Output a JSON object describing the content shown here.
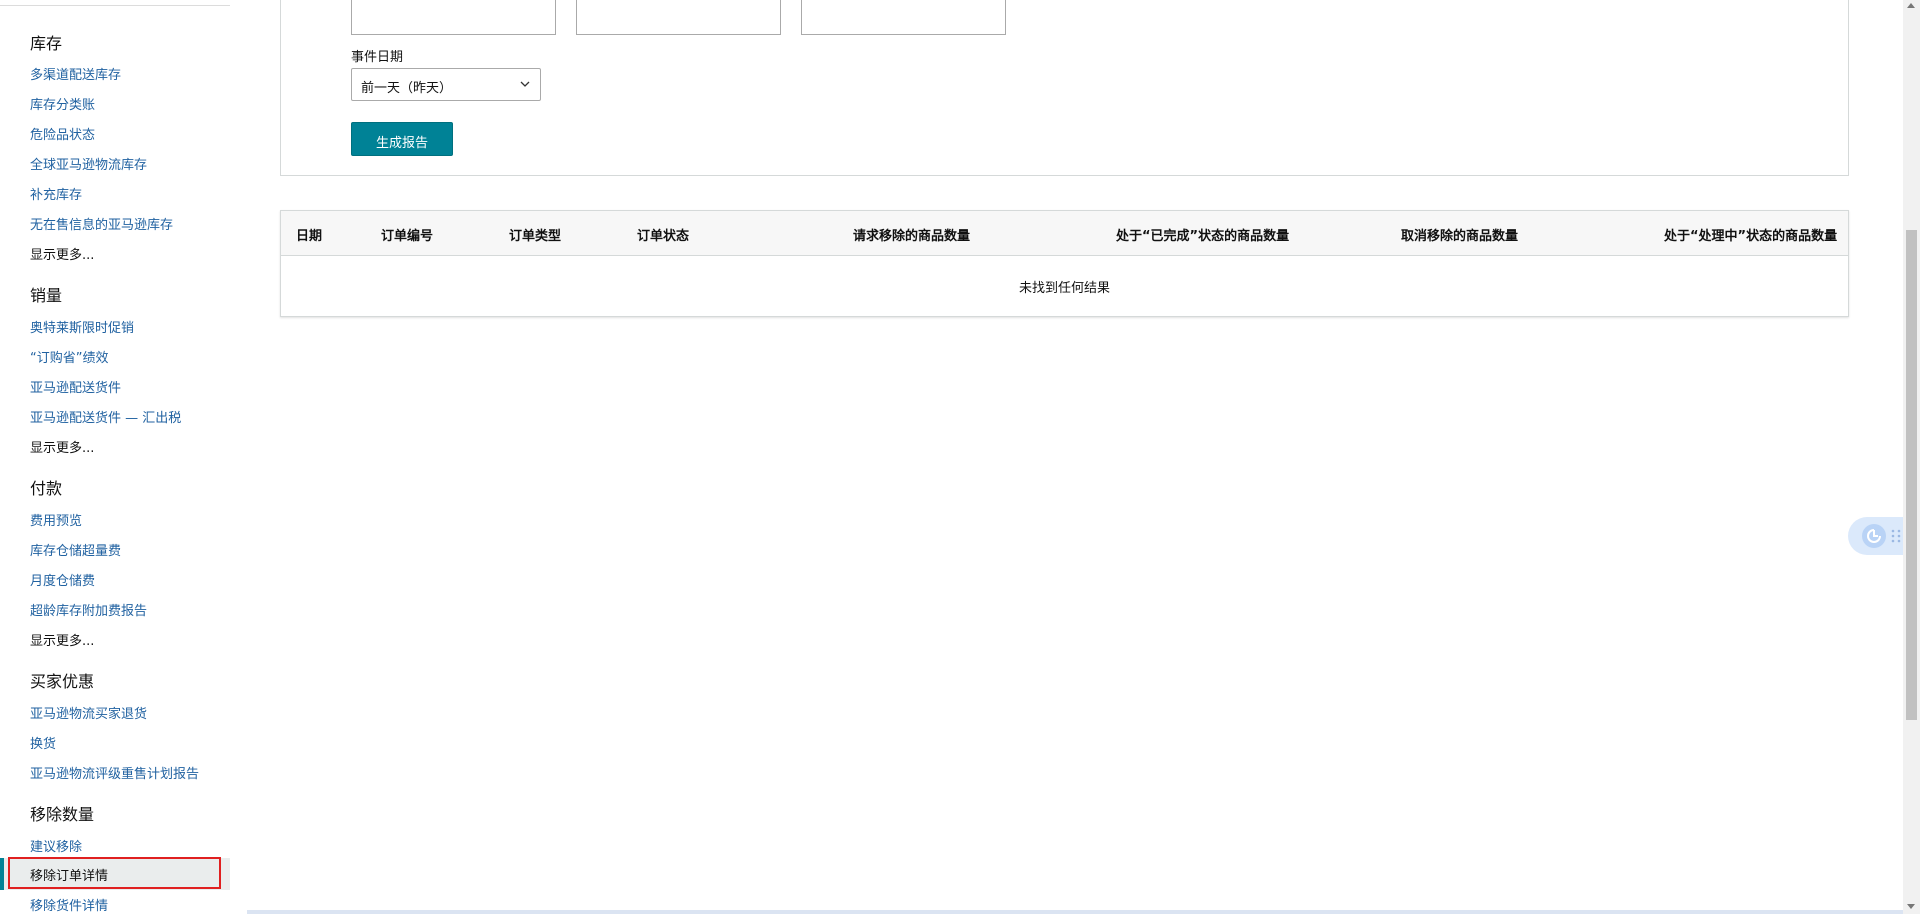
{
  "sidebar": {
    "sections": [
      {
        "title": "库存",
        "links": [
          "多渠道配送库存",
          "库存分类账",
          "危险品状态",
          "全球亚马逊物流库存",
          "补充库存",
          "无在售信息的亚马逊库存"
        ],
        "more": "显示更多..."
      },
      {
        "title": "销量",
        "links": [
          "奥特莱斯限时促销",
          "“订购省”绩效",
          "亚马逊配送货件",
          "亚马逊配送货件 — 汇出税"
        ],
        "more": "显示更多..."
      },
      {
        "title": "付款",
        "links": [
          "费用预览",
          "库存仓储超量费",
          "月度仓储费",
          "超龄库存附加费报告"
        ],
        "more": "显示更多..."
      },
      {
        "title": "买家优惠",
        "links": [
          "亚马逊物流买家退货",
          "换货",
          "亚马逊物流评级重售计划报告"
        ]
      },
      {
        "title": "移除数量",
        "links": [
          "建议移除",
          "移除订单详情",
          "移除货件详情"
        ]
      }
    ],
    "active_item": "移除订单详情"
  },
  "form": {
    "event_date_label": "事件日期",
    "event_date_value": "前一天（昨天）",
    "generate_button": "生成报告"
  },
  "table": {
    "columns": [
      "日期",
      "订单编号",
      "订单类型",
      "订单状态",
      "请求移除的商品数量",
      "处于“已完成”状态的商品数量",
      "取消移除的商品数量",
      "处于“处理中”状态的商品数量"
    ],
    "empty_message": "未找到任何结果"
  },
  "colors": {
    "accent": "#008296",
    "link": "#2162a1",
    "highlight_border": "#e02020"
  }
}
